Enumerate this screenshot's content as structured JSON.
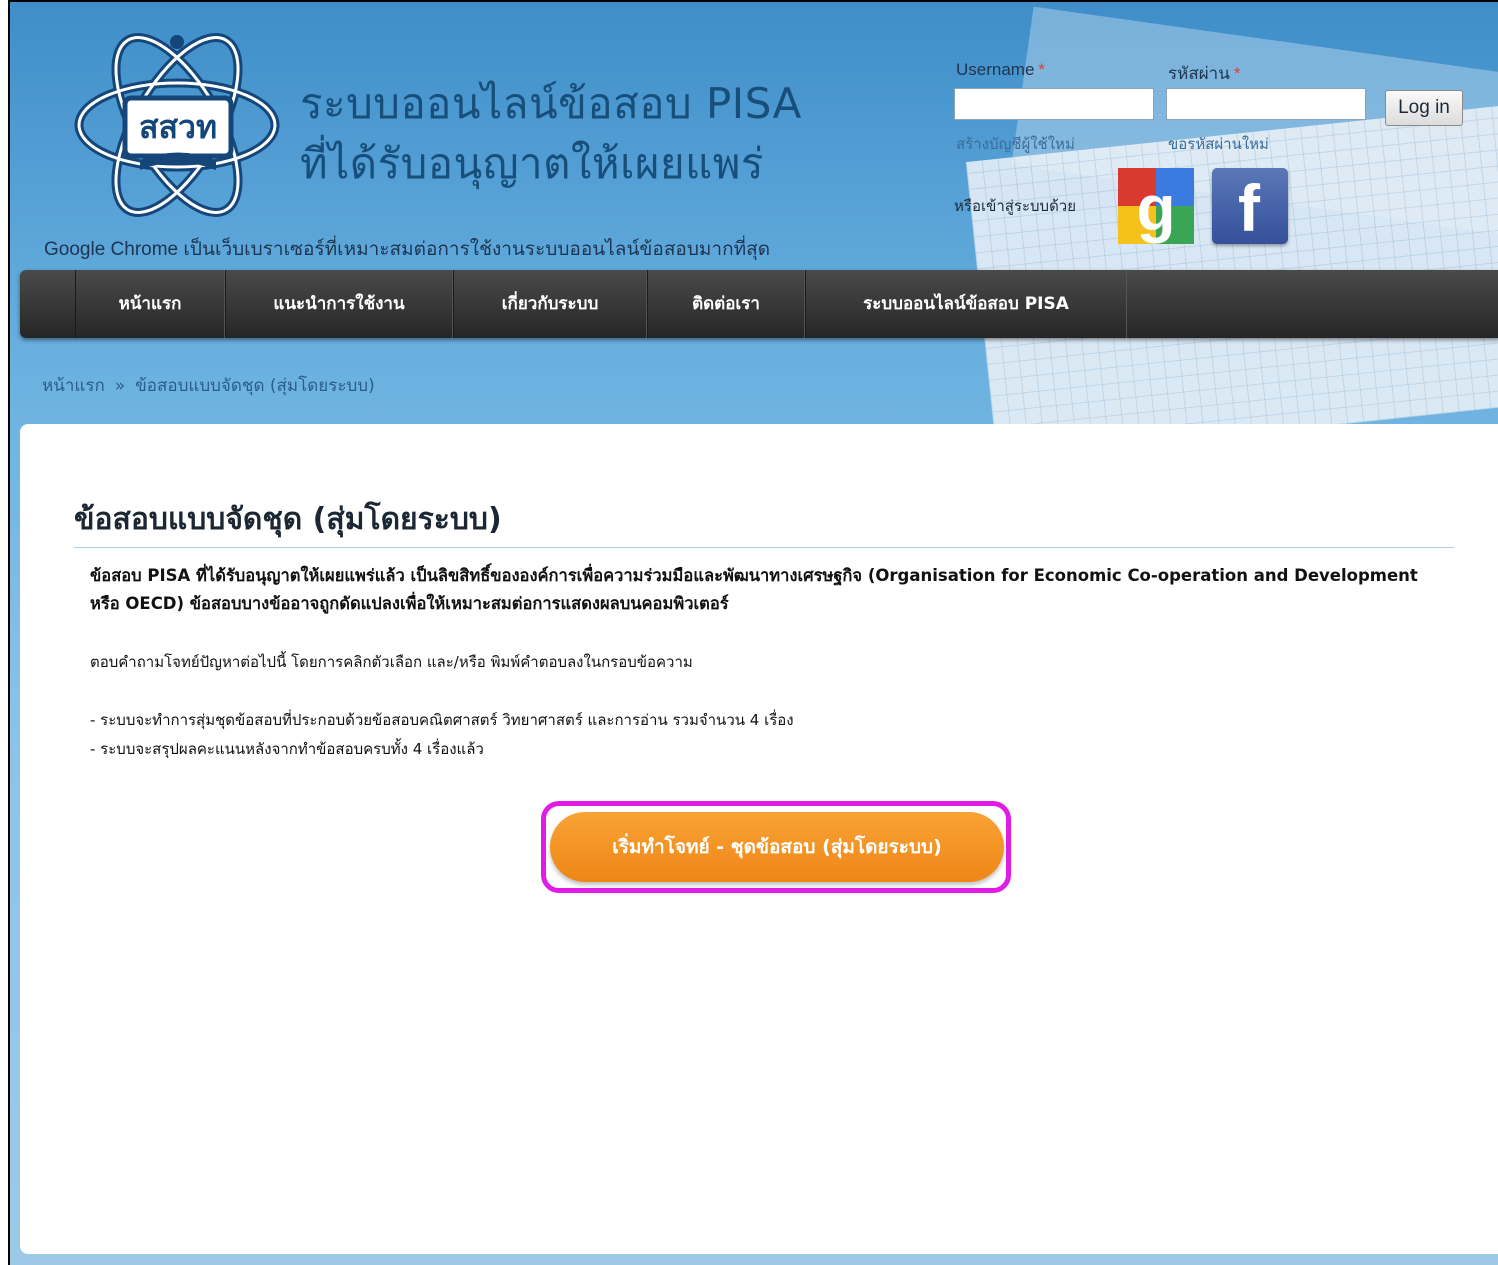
{
  "header": {
    "title_line1": "ระบบออนไลน์ข้อสอบ PISA",
    "title_line2": "ที่ได้รับอนุญาตให้เผยแพร่",
    "logo_text": "สสวท",
    "browser_note": "Google Chrome เป็นเว็บเบราเซอร์ที่เหมาะสมต่อการใช้งานระบบออนไลน์ข้อสอบมากที่สุด"
  },
  "login": {
    "username_label": "Username",
    "password_label": "รหัสผ่าน",
    "required_mark": "*",
    "username_value": "",
    "password_value": "",
    "login_button": "Log in",
    "create_account": "สร้างบัญชีผู้ใช้ใหม่",
    "reset_password": "ขอรหัสผ่านใหม่",
    "social_label": "หรือเข้าสู่ระบบด้วย",
    "google_icon": "google-plus-icon",
    "facebook_icon": "facebook-icon",
    "facebook_glyph": "f"
  },
  "nav": {
    "items": [
      {
        "label": "หน้าแรก"
      },
      {
        "label": "แนะนำการใช้งาน"
      },
      {
        "label": "เกี่ยวกับระบบ"
      },
      {
        "label": "ติดต่อเรา"
      },
      {
        "label": "ระบบออนไลน์ข้อสอบ PISA"
      }
    ]
  },
  "breadcrumb": {
    "home": "หน้าแรก",
    "separator": "»",
    "current": "ข้อสอบแบบจัดชุด (สุ่มโดยระบบ)"
  },
  "main": {
    "title": "ข้อสอบแบบจัดชุด (สุ่มโดยระบบ)",
    "intro": "ข้อสอบ PISA ที่ได้รับอนุญาตให้เผยแพร่แล้ว เป็นลิขสิทธิ์ขององค์การเพื่อความร่วมมือและพัฒนาทางเศรษฐกิจ (Organisation for Economic Co-operation and Development หรือ OECD) ข้อสอบบางข้ออาจถูกดัดแปลงเพื่อให้เหมาะสมต่อการแสดงผลบนคอมพิวเตอร์",
    "instruction": "ตอบคำถามโจทย์ปัญหาต่อไปนี้ โดยการคลิกตัวเลือก และ/หรือ พิมพ์คำตอบลงในกรอบข้อความ",
    "bullets": [
      "- ระบบจะทำการสุ่มชุดข้อสอบที่ประกอบด้วยข้อสอบคณิตศาสตร์ วิทยาศาสตร์ และการอ่าน รวมจำนวน 4 เรื่อง",
      "- ระบบจะสรุปผลคะแนนหลังจากทำข้อสอบครบทั้ง 4 เรื่องแล้ว"
    ],
    "start_button": "เริ่มทำโจทย์ - ชุดข้อสอบ (สุ่มโดยระบบ)"
  },
  "colors": {
    "accent_orange": "#f39a2a",
    "highlight_magenta": "#e01ce6",
    "header_blue": "#5aa4d8",
    "nav_dark": "#333333"
  }
}
